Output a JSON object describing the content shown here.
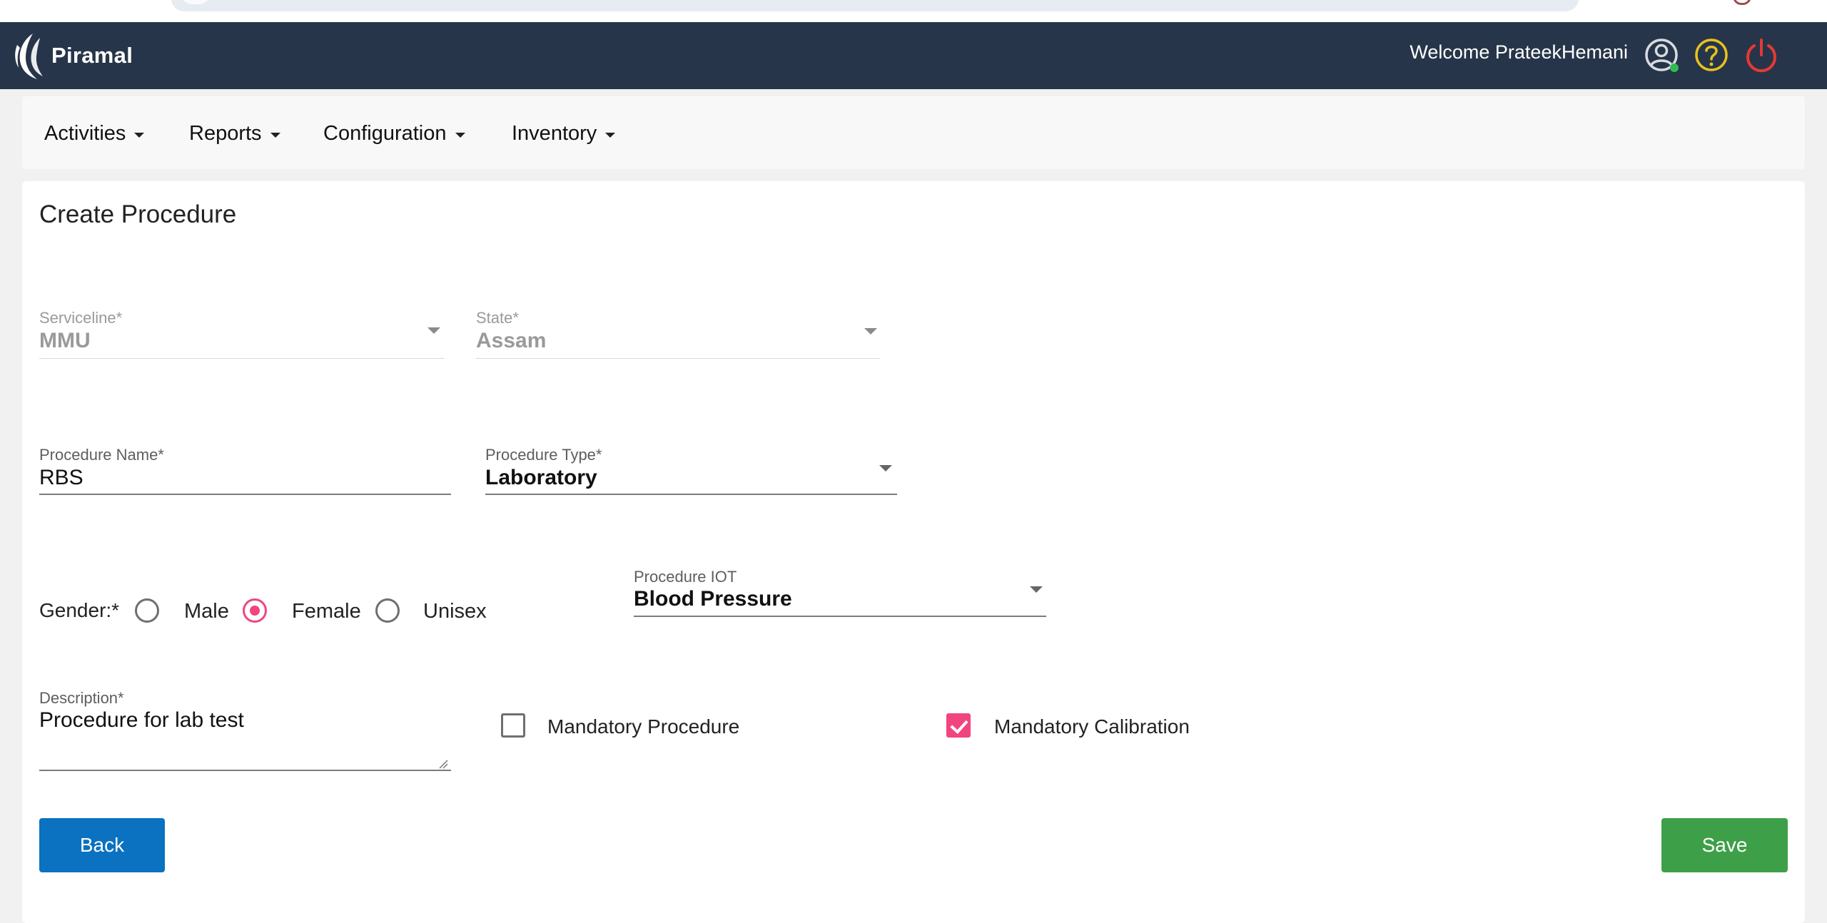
{
  "header": {
    "brand": "Piramal",
    "welcome": "Welcome PrateekHemani",
    "icons": [
      "user-status-icon",
      "help-icon",
      "power-icon"
    ],
    "colors": {
      "bar": "#263549",
      "help": "#e8c21e",
      "power": "#e53935",
      "online": "#2ebd52"
    }
  },
  "menu": {
    "items": [
      {
        "label": "Activities"
      },
      {
        "label": "Reports"
      },
      {
        "label": "Configuration"
      },
      {
        "label": "Inventory"
      }
    ]
  },
  "form": {
    "title": "Create Procedure",
    "serviceline": {
      "label": "Serviceline*",
      "value": "MMU"
    },
    "state": {
      "label": "State*",
      "value": "Assam"
    },
    "procedure_name": {
      "label": "Procedure Name*",
      "value": "RBS"
    },
    "procedure_type": {
      "label": "Procedure Type*",
      "value": "Laboratory"
    },
    "gender": {
      "label": "Gender:*",
      "options": [
        "Male",
        "Female",
        "Unisex"
      ],
      "selected": "Female"
    },
    "procedure_iot": {
      "label": "Procedure IOT",
      "value": "Blood Pressure"
    },
    "description": {
      "label": "Description*",
      "value": "Procedure for lab test"
    },
    "mandatory_procedure": {
      "label": "Mandatory Procedure",
      "checked": false
    },
    "mandatory_calibration": {
      "label": "Mandatory Calibration",
      "checked": true
    },
    "back_label": "Back",
    "save_label": "Save",
    "accent": "#f1457f"
  }
}
